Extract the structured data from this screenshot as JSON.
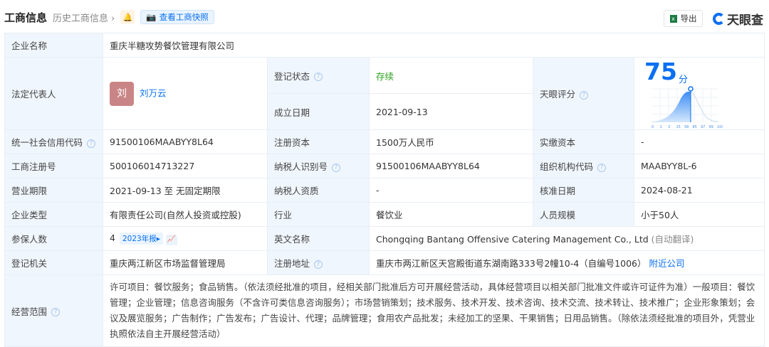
{
  "header": {
    "title": "工商信息",
    "history": "历史工商信息",
    "snapshot": "查看工商快照",
    "export": "导出",
    "logo": "天眼查"
  },
  "rows": {
    "name_label": "企业名称",
    "name": "重庆半糖攻势餐饮管理有限公司",
    "legal_label": "法定代表人",
    "legal_avatar": "刘",
    "legal": "刘万云",
    "status_label": "登记状态",
    "status": "存续",
    "founded_label": "成立日期",
    "founded": "2021-09-13",
    "score_label": "天眼评分",
    "score": "75",
    "score_unit": "分",
    "credit_label": "统一社会信用代码",
    "credit": "91500106MAABYY8L64",
    "capital_label": "注册资本",
    "capital": "1500万人民币",
    "paid_label": "实缴资本",
    "paid": "-",
    "reg_label": "工商注册号",
    "reg": "500106014713227",
    "tax_label": "纳税人识别号",
    "tax": "91500106MAABYY8L64",
    "org_label": "组织机构代码",
    "org": "MAABYY8L-6",
    "term_label": "营业期限",
    "term": "2021-09-13 至 无固定期限",
    "taxq_label": "纳税人资质",
    "taxq": "-",
    "approve_label": "核准日期",
    "approve": "2024-08-21",
    "type_label": "企业类型",
    "type": "有限责任公司(自然人投资或控股)",
    "industry_label": "行业",
    "industry": "餐饮业",
    "size_label": "人员规模",
    "size": "小于50人",
    "insured_label": "参保人数",
    "insured": "4",
    "insured_tag": "2023年报",
    "en_label": "英文名称",
    "en": "Chongqing Bantang Offensive Catering Management Co., Ltd",
    "en_note": "(自动翻译)",
    "authority_label": "登记机关",
    "authority": "重庆两江新区市场监督管理局",
    "addr_label": "注册地址",
    "addr": "重庆市两江新区天宫殿街道东湖南路333号2幢10-4（自编号1006）",
    "addr_link": "附近公司",
    "scope_label": "经营范围",
    "scope": "许可项目：餐饮服务；食品销售。（依法须经批准的项目，经相关部门批准后方可开展经营活动，具体经营项目以相关部门批准文件或许可证件为准）一般项目：餐饮管理；企业管理；信息咨询服务（不含许可类信息咨询服务）；市场营销策划；技术服务、技术开发、技术咨询、技术交流、技术转让、技术推广；企业形象策划；会议及展览服务；广告制作；广告发布；广告设计、代理；品牌管理；食用农产品批发；未经加工的坚果、干果销售；日用品销售。（除依法须经批准的项目外，凭营业执照依法自主开展经营活动）"
  },
  "score_chart": {
    "ticks": [
      "0",
      "1",
      "3",
      "15",
      "58",
      "85",
      "97",
      "99",
      "100"
    ],
    "marker": 75
  }
}
